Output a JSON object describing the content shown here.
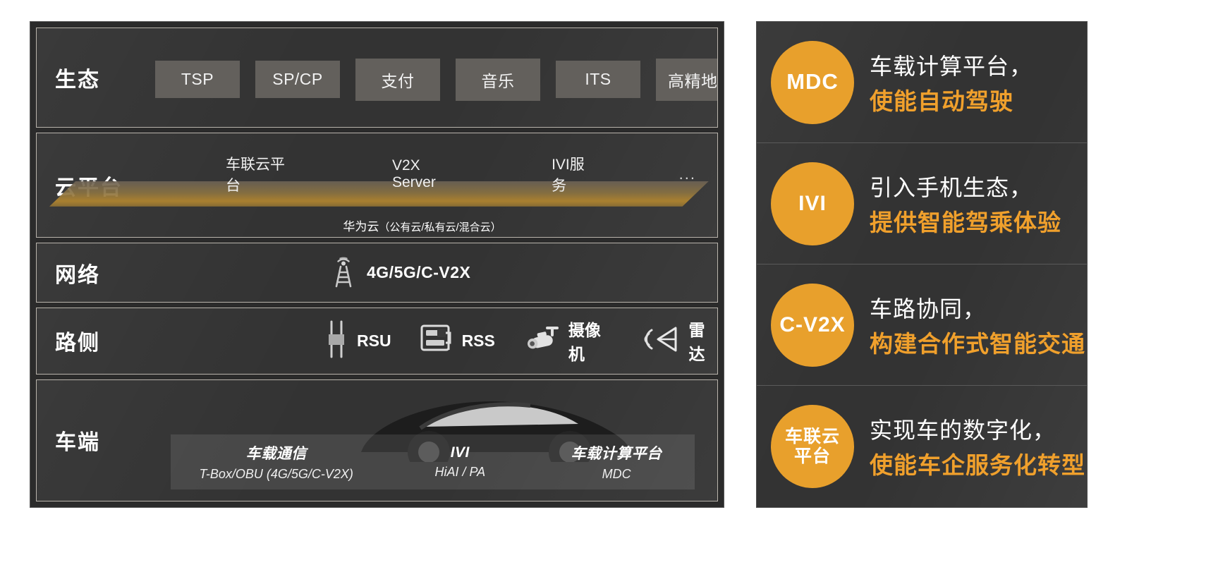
{
  "left_stack": {
    "layers": [
      {
        "id": "ecosystem",
        "title": "生态",
        "chips": [
          "TSP",
          "SP/CP",
          "支付",
          "音乐",
          "ITS",
          "高精地图"
        ],
        "ellipsis": "..."
      },
      {
        "id": "cloud-platform",
        "title": "云平台",
        "services": [
          "车联云平台",
          "V2X Server",
          "IVI服务"
        ],
        "ellipsis": "...",
        "subtitle_main": "华为云",
        "subtitle_paren": "（公有云/私有云/混合云）"
      },
      {
        "id": "network",
        "title": "网络",
        "icon": "cell-tower-icon",
        "label": "4G/5G/C-V2X"
      },
      {
        "id": "roadside",
        "title": "路侧",
        "items": [
          {
            "icon": "rsu-icon",
            "label": "RSU"
          },
          {
            "icon": "rss-server-icon",
            "label": "RSS"
          },
          {
            "icon": "camera-icon",
            "label": "摄像机"
          },
          {
            "icon": "radar-icon",
            "label": "雷达"
          }
        ]
      },
      {
        "id": "vehicle",
        "title": "车端",
        "art": "car-silhouette",
        "columns": [
          {
            "title": "车载通信",
            "sub": "T-Box/OBU  (4G/5G/C-V2X)"
          },
          {
            "title": "IVI",
            "sub": "HiAI / PA"
          },
          {
            "title": "车载计算平台",
            "sub": "MDC"
          }
        ]
      }
    ]
  },
  "right_panel": {
    "bullets": [
      {
        "badge": "MDC",
        "badge_size": "lg",
        "line1": "车载计算平台，",
        "line2": "使能自动驾驶"
      },
      {
        "badge": "IVI",
        "badge_size": "md",
        "line1": "引入手机生态，",
        "line2": "提供智能驾乘体验"
      },
      {
        "badge": "C-V2X",
        "badge_size": "md",
        "line1": "车路协同，",
        "line2": "构建合作式智能交通"
      },
      {
        "badge": "车联云\n平台",
        "badge_size": "cn",
        "line1": "实现车的数字化，",
        "line2": "使能车企服务化转型"
      }
    ]
  },
  "colors": {
    "accent_orange": "#e8a02c",
    "panel_bg": "#333333",
    "page_bg": "#ffffff",
    "chip_bg": "#63605c",
    "border": "#b9b4ac"
  }
}
